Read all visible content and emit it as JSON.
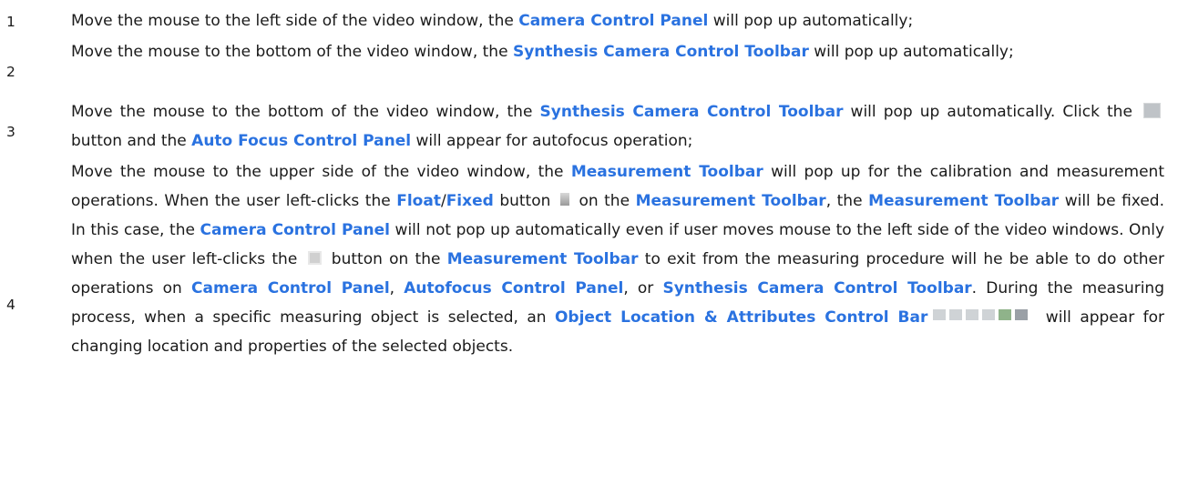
{
  "steps": [
    {
      "number": "1",
      "parts": [
        "Move the mouse to the left side of the video window, the ",
        "Camera Control Panel",
        " will pop up automatically;"
      ]
    },
    {
      "number": "2",
      "parts": [
        "Move the mouse to the bottom of the video window, the ",
        "Synthesis Camera Control Toolbar",
        " will pop up automatically;"
      ]
    },
    {
      "number": "3",
      "parts": [
        "Move the mouse to the bottom of the video window, the ",
        "Synthesis Camera Control Toolbar",
        " will pop up automatically. Click the ",
        " button and the ",
        "Auto Focus Control Panel",
        " will appear for autofocus operation;"
      ]
    },
    {
      "number": "4",
      "parts": [
        "Move the mouse to the upper side of the video window, the ",
        "Measurement Toolbar",
        " will pop up for the calibration and measurement operations. When the user left-clicks the ",
        "Float",
        "/",
        "Fixed",
        " button ",
        " on the ",
        "Measurement Toolbar",
        ", the ",
        "Measurement Toolbar",
        " will be fixed. In this case, the ",
        "Camera Control Panel",
        " will not pop up automatically even if user moves mouse to the left side of the video windows. Only when the user left-clicks the ",
        " button on the ",
        "Measurement Toolbar",
        " to exit from the measuring procedure will he be able to do other operations on ",
        "Camera Control Panel",
        ", ",
        "Autofocus Control Panel",
        ", or ",
        "Synthesis Camera Control Toolbar",
        ". During the measuring process, when a specific measuring object is selected, an ",
        "Object Location & Attributes Control Bar",
        " will appear for changing location and properties of the selected objects."
      ]
    }
  ],
  "colors": {
    "highlight": "#2a72e0",
    "text": "#1a1a1a"
  },
  "icons": [
    "auto-focus-button-icon",
    "float-fixed-button-icon",
    "exit-measure-button-icon",
    "object-location-attributes-bar-icons"
  ]
}
